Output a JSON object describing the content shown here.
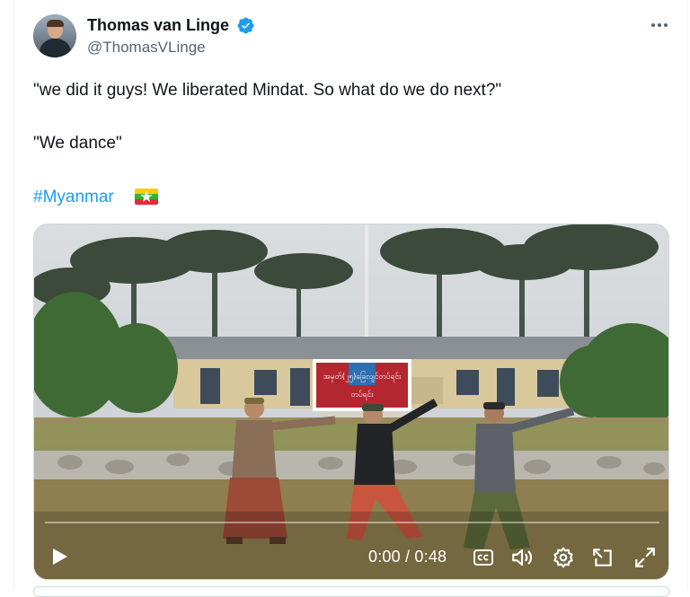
{
  "author": {
    "name": "Thomas van Linge",
    "handle": "@ThomasVLinge",
    "verified": true,
    "verified_color": "#1d9bf0"
  },
  "tweet": {
    "line1": "\"we did it guys! We liberated Mindat. So what do we do next?\"",
    "line2": "\"We dance\"",
    "hashtag": "#Myanmar",
    "flag_icon": "myanmar-flag-icon"
  },
  "video": {
    "time_display": "0:00 / 0:48",
    "progress": 0,
    "sign_line1": "အမှတ်(၂၅)ခြေလျင်တပ်ရင်း",
    "sign_line2": "တပ်ရင်း"
  },
  "colors": {
    "text": "#0f1419",
    "secondary": "#536471",
    "accent": "#1d9bf0",
    "border": "#cfd9de"
  }
}
